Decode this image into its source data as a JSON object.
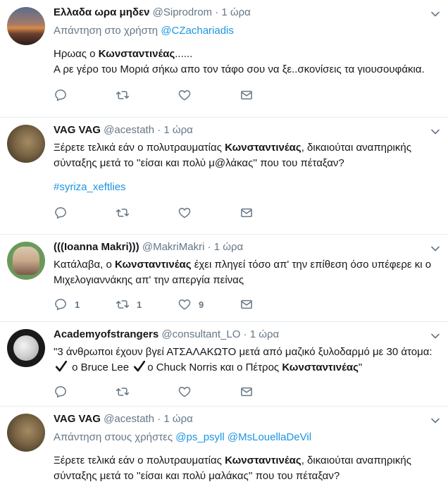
{
  "tweets": [
    {
      "name": "Ελλαδα ωρα μηδεν",
      "handle": "@Siprodrom",
      "time": "1 ώρα",
      "reply_prefix": "Απάντηση στο χρήστη",
      "reply_to": "@CZachariadis",
      "line1_pre": "Ηρωας ο ",
      "line1_bold": "Κωνσταντινέας",
      "line1_post": "......",
      "line2": "Α ρε γέρο του Μοριά σήκω απο τον τάφο σου να ξε..σκονίσεις τα γιουσουφάκια."
    },
    {
      "name": "VAG VAG",
      "handle": "@acestath",
      "time": "1 ώρα",
      "text_pre": "Ξέρετε τελικά εάν ο πολυτραυματίας ",
      "text_bold": "Κωνσταντινέας",
      "text_post": ", δικαιούται αναπηρικής σύνταξης μετά το ''είσαι και πολύ μ@λάκας''  που του πέταξαν?",
      "hashtag": "#syriza_xeftlies"
    },
    {
      "name": "(((Ioanna Makri)))",
      "handle": "@MakriMakri",
      "time": "1 ώρα",
      "text_pre": "Κατάλαβα, ο ",
      "text_bold": "Κωνσταντινέας",
      "text_post": "  έχει πληγεί  τόσο απ' την επίθεση όσο υπέφερε κι ο Μιχελογιαννάκης απ' την απεργία πείνας",
      "reply_count": "1",
      "retweet_count": "1",
      "like_count": "9"
    },
    {
      "name": "Academyofstrangers",
      "handle": "@consultant_LO",
      "time": "1 ώρα",
      "text_a": "\"3 άνθρωποι έχουν βγεί ΑΤΣΑΛΑΚΩΤΟ μετά από μαζικό ξυλοδαρμό με 30 άτομα: ",
      "text_b": " ο Bruce Lee ",
      "text_c": "ο Chuck Norris και ο Πέτρος ",
      "text_bold": "Κωνσταντινέας",
      "text_end": "\""
    },
    {
      "name": "VAG VAG",
      "handle": "@acestath",
      "time": "1 ώρα",
      "reply_prefix": "Απάντηση στους χρήστες",
      "reply_to_1": "@ps_psyll",
      "reply_to_2": "@MsLouellaDeVil",
      "text_pre": "Ξέρετε τελικά εάν ο πολυτραυματίας ",
      "text_bold": "Κωνσταντινέας",
      "text_post": ", δικαιούται αναπηρικής σύνταξης μετά το ''είσαι και πολύ μαλάκας''  που του πέταξαν?"
    }
  ],
  "separator": "·",
  "icons": [
    "reply-icon",
    "retweet-icon",
    "like-icon",
    "direct-message-icon",
    "caret-down-icon",
    "check-mark-icon"
  ],
  "colors": {
    "link": "#1b95e0",
    "muted": "#657786",
    "text": "#14171a"
  }
}
